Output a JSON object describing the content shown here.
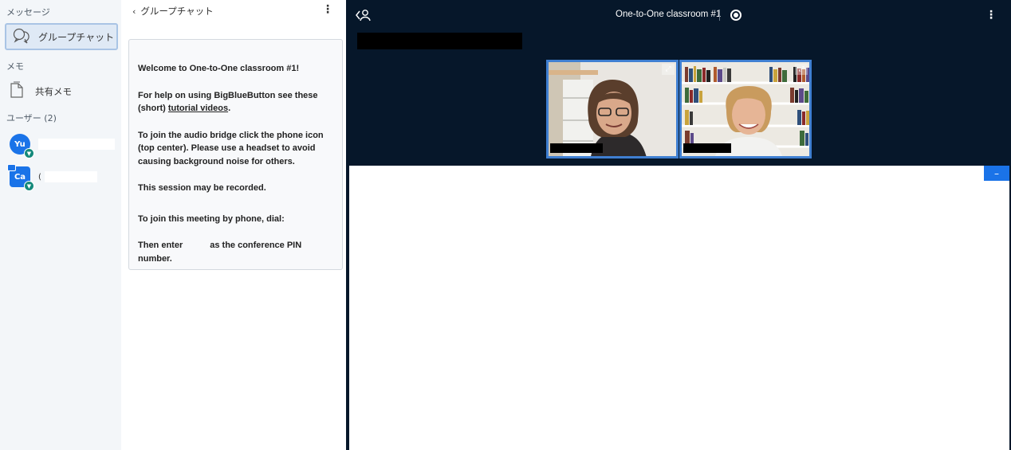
{
  "sidebar": {
    "messages_heading": "メッセージ",
    "group_chat_label": "グループチャット",
    "notes_heading": "メモ",
    "shared_notes_label": "共有メモ",
    "users_heading": "ユーザー (2)",
    "users": [
      {
        "initials": "Yu",
        "avatar_color": "#1a73e8",
        "presenter": false,
        "mic": "listen"
      },
      {
        "initials": "Ca",
        "avatar_color": "#1a73e8",
        "presenter": true,
        "prefix": "(",
        "mic": "listen"
      }
    ]
  },
  "chat": {
    "header_label": "グループチャット",
    "welcome": {
      "line1": "Welcome to One-to-One classroom #1!",
      "line2_pre": "For help on using BigBlueButton see these (short) ",
      "line2_link": "tutorial videos",
      "line2_post": ".",
      "line3": "To join the audio bridge click the phone icon (top center). Please use a headset to avoid causing background noise for others.",
      "line4": "This session may be recorded.",
      "line5": "To join this meeting by phone, dial:",
      "line6_pre": "Then enter",
      "line6_post": "as the conference PIN number."
    }
  },
  "main": {
    "session_title": "One-to-One classroom #1",
    "colors": {
      "background": "#06172a",
      "accent": "#1a73e8",
      "tile_border": "#3f7fd1"
    },
    "minimize_label": "–"
  },
  "icons": [
    "chat-bubbles-icon",
    "notes-document-icon",
    "mic-listen-icon",
    "user-list-toggle-icon",
    "record-icon",
    "kebab-menu-icon",
    "fullscreen-icon",
    "chevron-left-icon"
  ]
}
